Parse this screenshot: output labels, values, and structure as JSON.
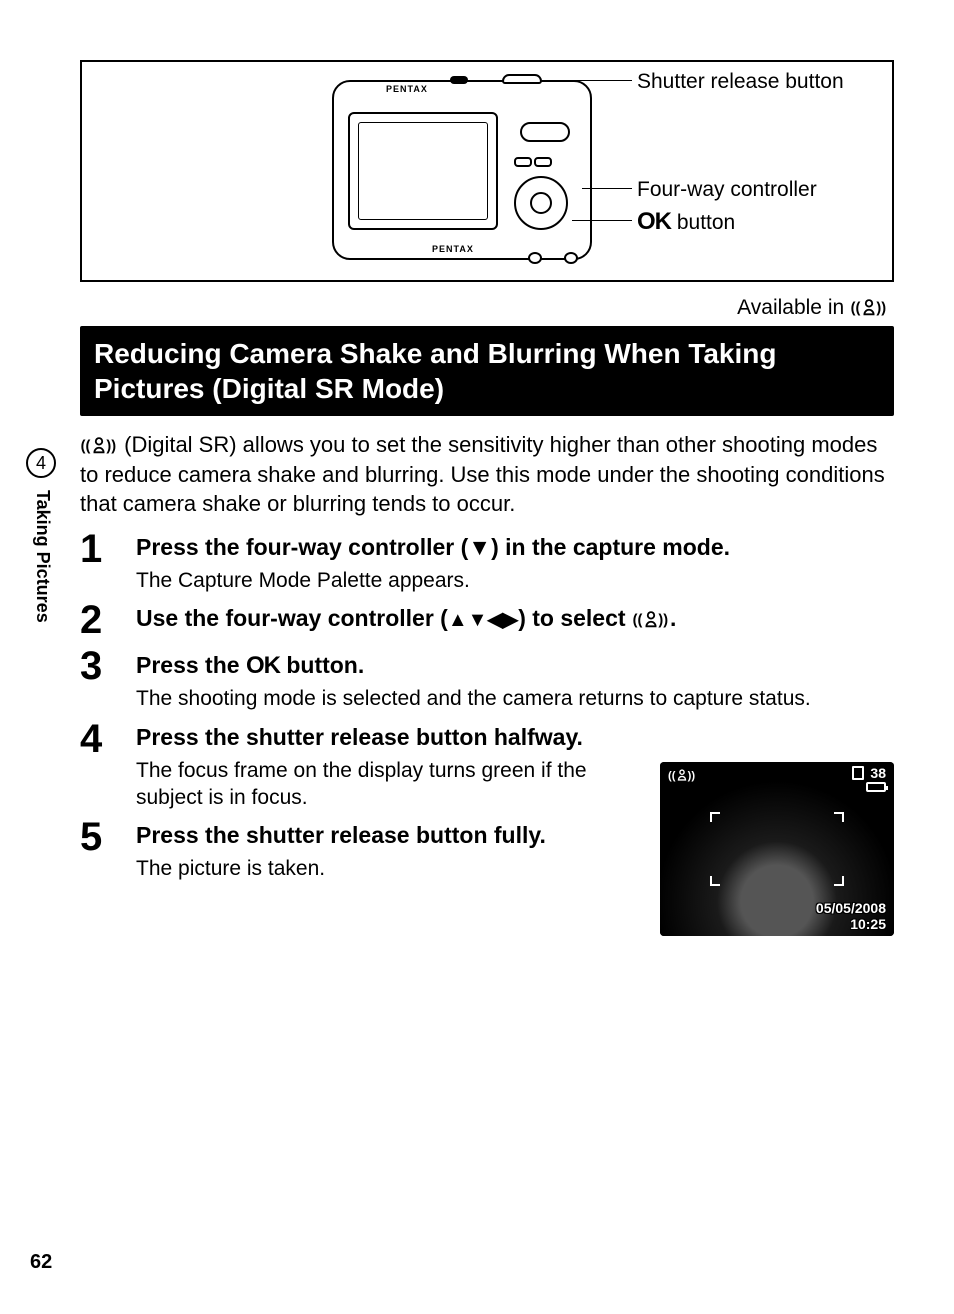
{
  "diagram": {
    "brand": "PENTAX",
    "callouts": {
      "shutter": "Shutter release button",
      "fourway": "Four-way controller",
      "ok_prefix": "OK",
      "ok_suffix": " button"
    }
  },
  "available_label": "Available in ",
  "sr_icon_alt": "Digital SR",
  "heading": "Reducing Camera Shake and Blurring When Taking Pictures (Digital SR Mode)",
  "intro_suffix": " (Digital SR) allows you to set the sensitivity higher than other shooting modes to reduce camera shake and blurring. Use this mode under the shooting conditions that camera shake or blurring tends to occur.",
  "steps": [
    {
      "num": "1",
      "title": "Press the four-way controller (▼) in the capture mode.",
      "desc": "The Capture Mode Palette appears."
    },
    {
      "num": "2",
      "title_pre": "Use the four-way controller (",
      "title_arrows": "▲▼◀▶",
      "title_mid": ") to select ",
      "title_post": "."
    },
    {
      "num": "3",
      "title_pre": "Press the ",
      "title_ok": "OK",
      "title_post": " button.",
      "desc": "The shooting mode is selected and the camera returns to capture status."
    },
    {
      "num": "4",
      "title": "Press the shutter release button halfway.",
      "desc": "The focus frame on the display turns green if the subject is in focus."
    },
    {
      "num": "5",
      "title": "Press the shutter release button fully.",
      "desc": "The picture is taken."
    }
  ],
  "lcd": {
    "count": "38",
    "date": "05/05/2008",
    "time": "10:25"
  },
  "side": {
    "chapter": "4",
    "label": "Taking Pictures"
  },
  "page_number": "62"
}
